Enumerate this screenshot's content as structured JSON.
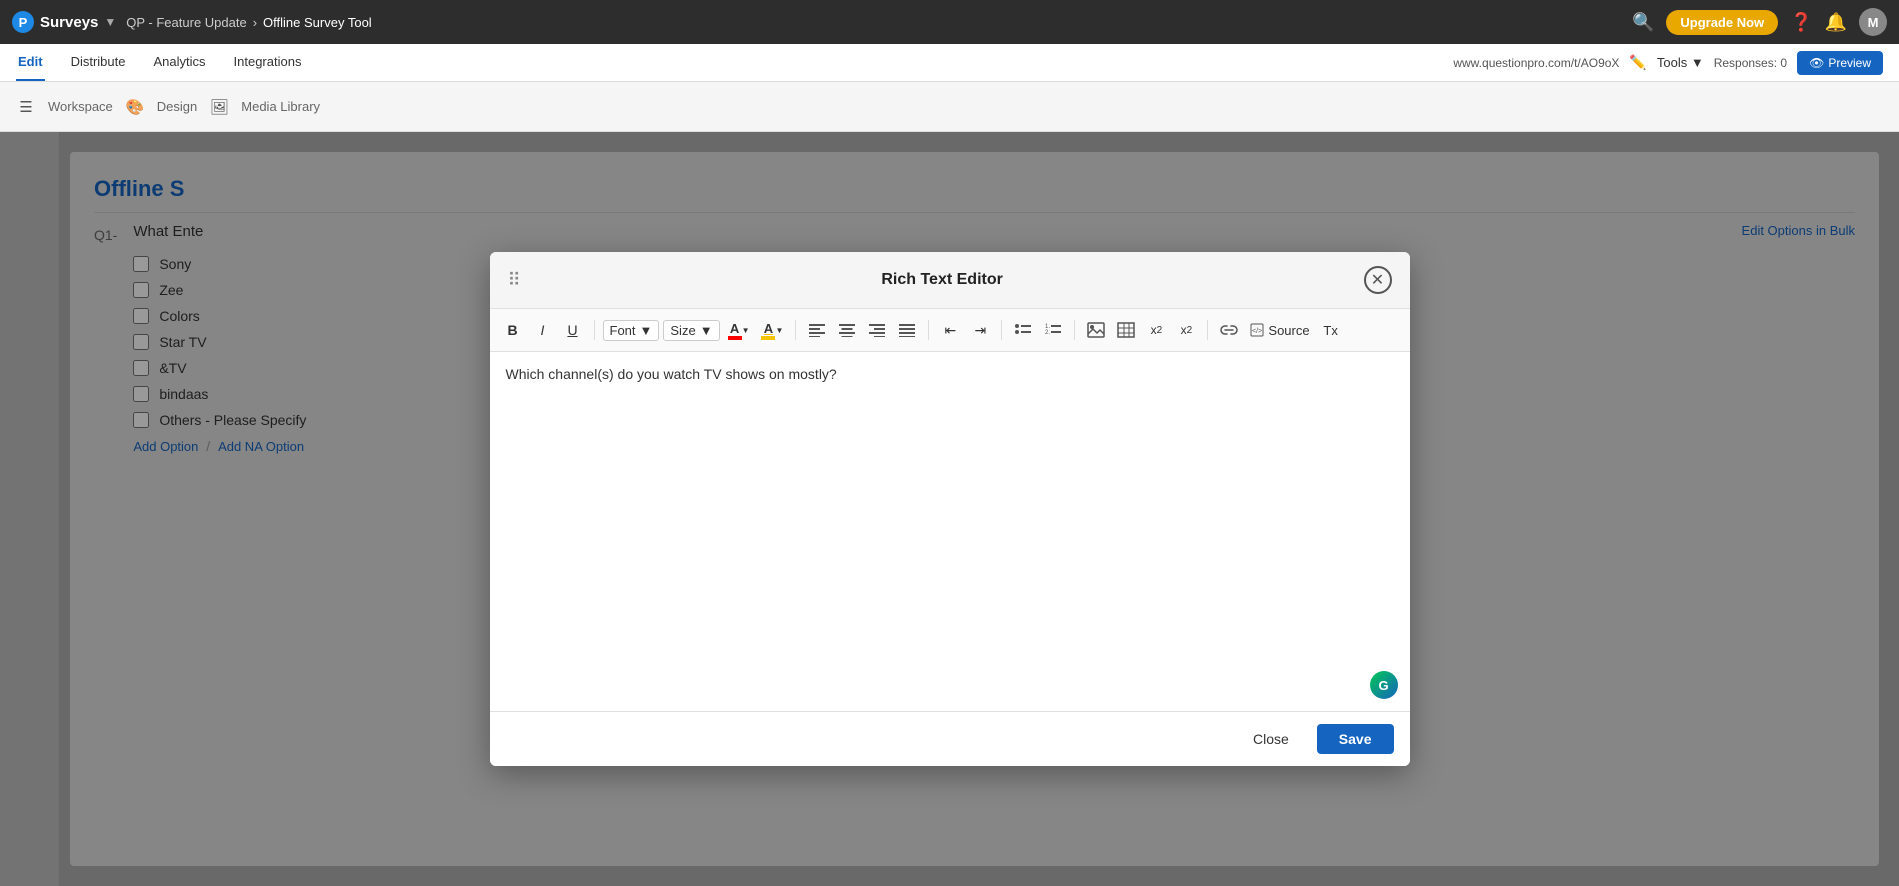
{
  "app": {
    "logo": "P",
    "brand": "Surveys",
    "breadcrumb": {
      "item1": "QP - Feature Update",
      "sep": "›",
      "item2": "Offline Survey Tool"
    }
  },
  "topbar": {
    "upgrade_label": "Upgrade Now",
    "responses_label": "Responses: 0",
    "tools_label": "Tools ▼",
    "survey_url": "www.questionpro.com/t/AO9oX",
    "preview_label": "Preview",
    "avatar": "M"
  },
  "nav": {
    "tabs": [
      {
        "label": "Edit",
        "active": true
      },
      {
        "label": "Distribute",
        "active": false
      },
      {
        "label": "Analytics",
        "active": false
      },
      {
        "label": "Integrations",
        "active": false
      }
    ]
  },
  "toolbar": {
    "workspace_label": "Workspace",
    "design_label": "Design",
    "media_label": "Media Library"
  },
  "survey": {
    "title": "Offline S",
    "question_num": "Q1-",
    "question_text": "What Ente",
    "checkboxes": [
      {
        "label": "Sony"
      },
      {
        "label": "Zee"
      },
      {
        "label": "Colors"
      },
      {
        "label": "Star TV"
      },
      {
        "label": "&TV"
      },
      {
        "label": "bindaas"
      },
      {
        "label": "Others - Please Specify"
      }
    ],
    "add_option": "Add Option",
    "add_na": "Add NA Option",
    "sep": "/",
    "edit_bulk": "Edit Options in Bulk"
  },
  "modal": {
    "title": "Rich Text Editor",
    "toolbar": {
      "bold": "B",
      "italic": "I",
      "underline": "U",
      "font_label": "Font",
      "font_dropdown_arrow": "▼",
      "size_label": "Size",
      "size_dropdown_arrow": "▼",
      "align_left": "≡",
      "align_center": "≡",
      "align_right": "≡",
      "align_justify": "≡",
      "outdent": "⇤",
      "indent": "⇥",
      "unordered_list": "•",
      "ordered_list": "1.",
      "image": "🖼",
      "table": "⊞",
      "subscript": "x₂",
      "superscript": "x²",
      "link": "🔗",
      "source_label": "Source",
      "clear_format": "Tx"
    },
    "editor_content": "Which channel(s) do you watch TV shows on mostly?",
    "grammarly": "G",
    "close_label": "Close",
    "save_label": "Save"
  }
}
